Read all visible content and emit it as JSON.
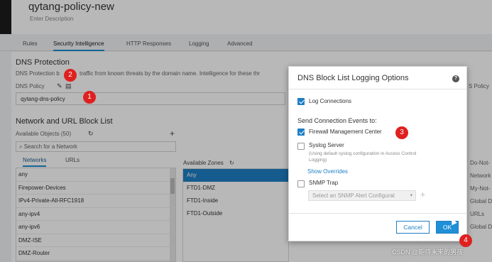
{
  "header": {
    "title": "qytang-policy-new",
    "description": "Enter Description"
  },
  "tabs": [
    {
      "label": "Rules"
    },
    {
      "label": "Security Intelligence"
    },
    {
      "label": "HTTP Responses"
    },
    {
      "label": "Logging"
    },
    {
      "label": "Advanced"
    }
  ],
  "dns": {
    "heading": "DNS Protection",
    "description": "DNS Protection b",
    "description_rest": "traffic from known threats by the domain name. Intelligence for these thr",
    "policy_label": "DNS Policy",
    "policy_value": "qytang-dns-policy",
    "right_label": "S Policy"
  },
  "network": {
    "heading": "Network and URL Block List",
    "available_objects": "Available Objects (50)",
    "search_placeholder": "Search for a Network",
    "subtabs": [
      "Networks",
      "URLs"
    ],
    "objects": [
      "any",
      "Firepower-Devices",
      "IPv4-Private-All-RFC1918",
      "any-ipv4",
      "any-ipv6",
      "DMZ-ISE",
      "DMZ-Router"
    ],
    "zones_label": "Available Zones",
    "zones": [
      "Any",
      "FTD1-DMZ",
      "FTD1-Inside",
      "FTD1-Outside"
    ],
    "right_items": [
      "Do-Not-",
      "Network",
      "My-Not-",
      "Global D",
      "URLs",
      "Global D"
    ]
  },
  "modal": {
    "title": "DNS Block List Logging Options",
    "help_icon": "?",
    "log_connections": {
      "label": "Log Connections",
      "checked": true
    },
    "send_events_heading": "Send Connection Events to:",
    "fmc": {
      "label": "Firewall Management Center",
      "checked": true
    },
    "syslog": {
      "label": "Syslog Server",
      "checked": false,
      "hint": "(Using default syslog configuration in Access Control Logging)",
      "link": "Show Overrides"
    },
    "snmp": {
      "label": "SNMP Trap",
      "checked": false,
      "placeholder": "Select an SNMP Alert Configurat"
    },
    "cancel": "Cancel",
    "ok": "OK"
  },
  "badges": [
    "1",
    "2",
    "3",
    "4"
  ],
  "watermark": "CSDN @期待未来的男孩",
  "colors": {
    "accent": "#1f7ec4",
    "badge": "#e02020"
  }
}
